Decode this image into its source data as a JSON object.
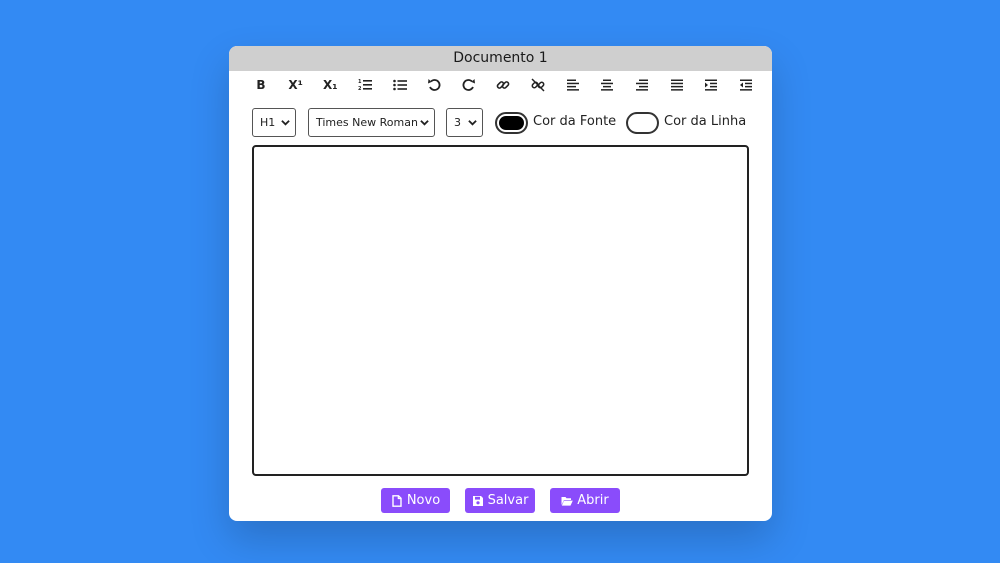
{
  "window": {
    "title": "Documento 1"
  },
  "toolbar": {
    "bold": "B",
    "superscript": "X¹",
    "subscript": "X₁"
  },
  "controls": {
    "heading_select": "H1",
    "font_select": "Times New Roman",
    "size_select": "3",
    "font_color_label": "Cor da Fonte",
    "font_color": "#000000",
    "line_color_label": "Cor da Linha",
    "line_color": "#ffffff"
  },
  "editor": {
    "content": ""
  },
  "actions": {
    "new_label": "Novo",
    "save_label": "Salvar",
    "open_label": "Abrir"
  },
  "colors": {
    "background": "#338af3",
    "titlebar": "#cfcfcf",
    "button": "#8a4cfb"
  }
}
